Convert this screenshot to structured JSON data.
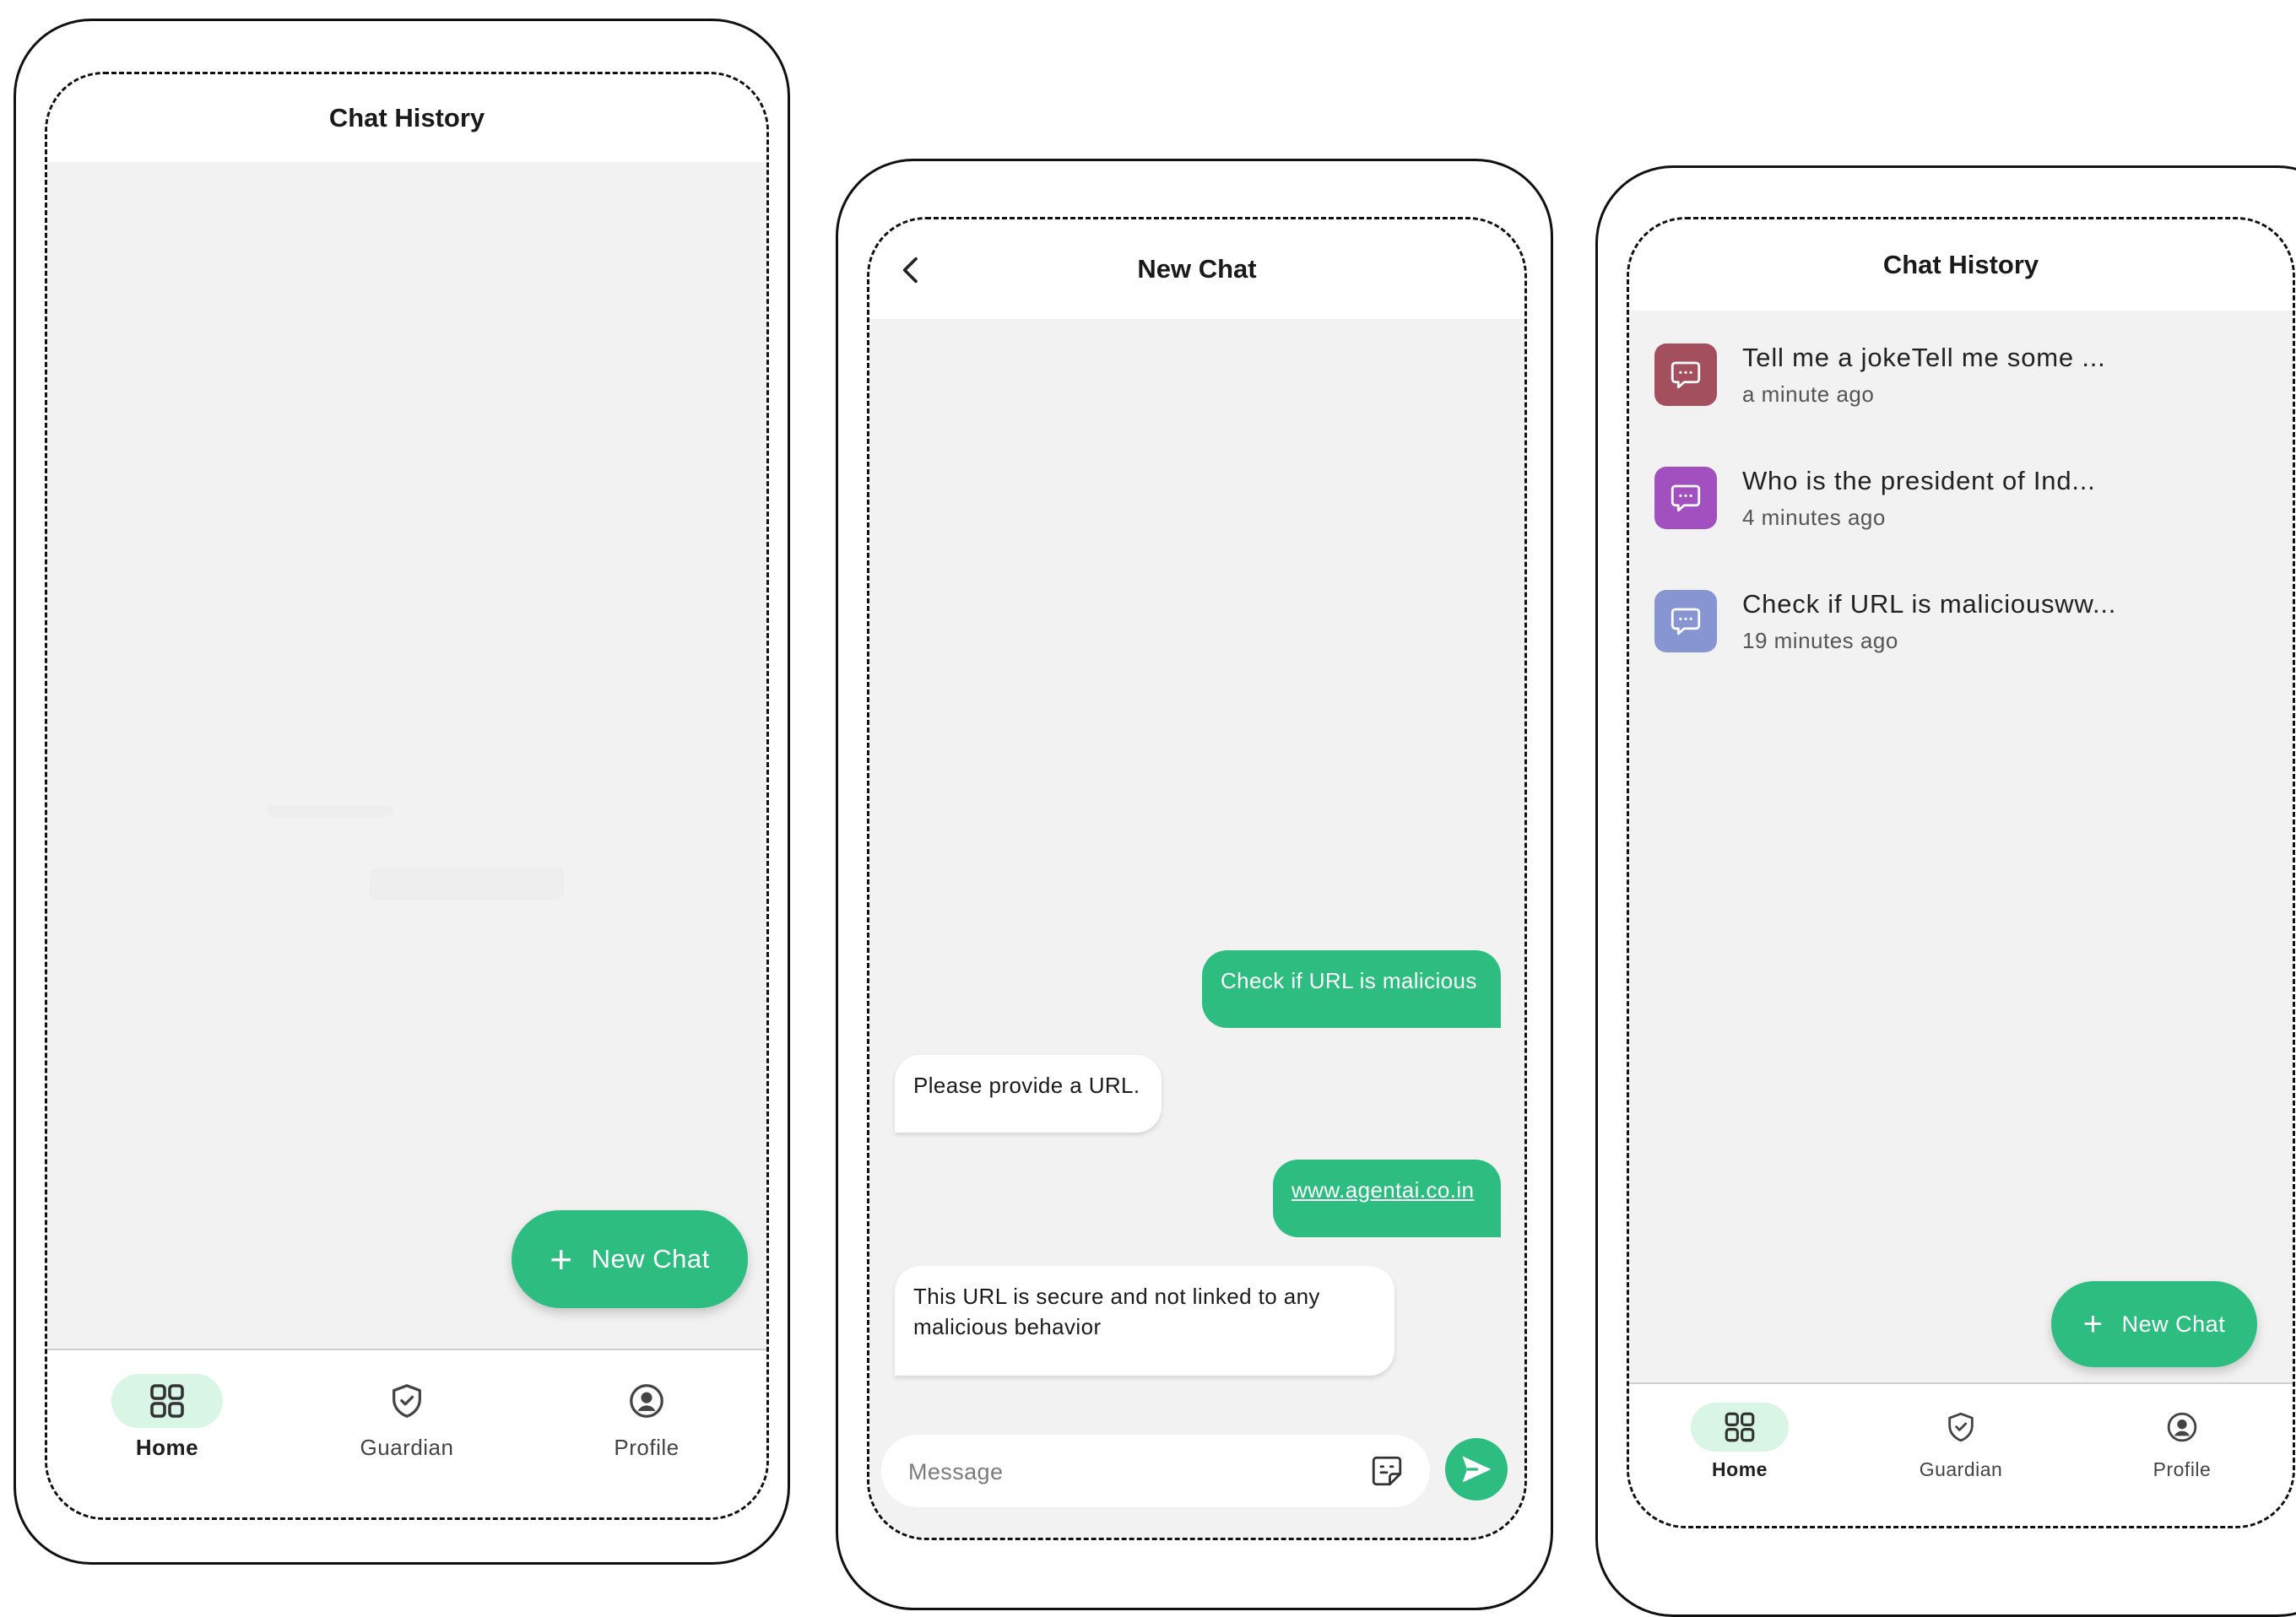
{
  "screen1": {
    "title": "Chat History",
    "fab_label": "New Chat",
    "nav": [
      {
        "label": "Home",
        "icon": "grid-icon",
        "active": true
      },
      {
        "label": "Guardian",
        "icon": "shield-check-icon",
        "active": false
      },
      {
        "label": "Profile",
        "icon": "user-circle-icon",
        "active": false
      }
    ]
  },
  "screen2": {
    "title": "New Chat",
    "messages": [
      {
        "role": "user",
        "text": "Check if URL is malicious"
      },
      {
        "role": "bot",
        "text": "Please provide a URL."
      },
      {
        "role": "user",
        "text": "www.agentai.co.in"
      },
      {
        "role": "bot",
        "text": "This URL is secure and not linked to any malicious behavior"
      }
    ],
    "input_placeholder": "Message"
  },
  "screen3": {
    "title": "Chat History",
    "history": [
      {
        "title": "Tell me a jokeTell me some ...",
        "time": "a minute ago",
        "color": "#a44f5e"
      },
      {
        "title": "Who is the president of Ind...",
        "time": "4 minutes ago",
        "color": "#a24fc0"
      },
      {
        "title": "Check if URL is maliciousww...",
        "time": "19 minutes ago",
        "color": "#8795d2"
      }
    ],
    "fab_label": "New Chat",
    "nav": [
      {
        "label": "Home",
        "icon": "grid-icon",
        "active": true
      },
      {
        "label": "Guardian",
        "icon": "shield-check-icon",
        "active": false
      },
      {
        "label": "Profile",
        "icon": "user-circle-icon",
        "active": false
      }
    ]
  },
  "colors": {
    "accent": "#2ebd80",
    "nav_active_bg": "#d8f5e6",
    "content_bg": "#f2f2f2"
  }
}
